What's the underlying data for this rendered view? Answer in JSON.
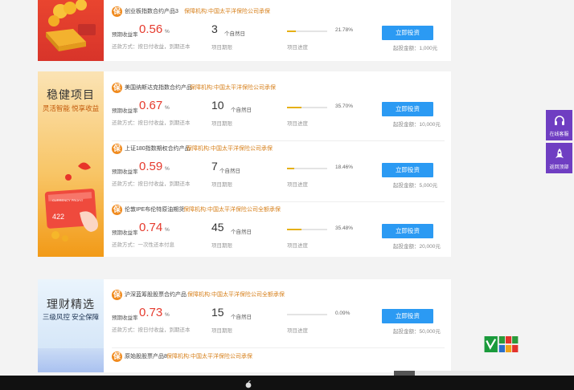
{
  "sections": [
    {
      "title": "",
      "subtitle": "",
      "products": [
        {
          "name": "创业板指数合约产品3",
          "guarantee": "保障机构:中国太平洋保险公司承保",
          "rate_label": "预期收益率",
          "rate": "0.56",
          "pct": "%",
          "repay": "还款方式：按日付收益，到期还本",
          "term": "3",
          "term_unit": "个自然日",
          "term_label": "项目期限",
          "progress": "21.78%",
          "progress_value": 21.78,
          "progress_label": "项目进度",
          "button": "立即投资",
          "min": "起投金额：1,000元"
        }
      ]
    },
    {
      "title": "稳健项目",
      "subtitle": "灵活智能 悦享收益",
      "card_text": "422",
      "card_text_small": "CURRENCY PROFIT",
      "products": [
        {
          "name": "美国纳斯达克指数合约产品",
          "guarantee": "保障机构:中国太平洋保险公司承保",
          "rate_label": "预期收益率",
          "rate": "0.67",
          "pct": "%",
          "repay": "还款方式：按日付收益，到期还本",
          "term": "10",
          "term_unit": "个自然日",
          "term_label": "项目期限",
          "progress": "35.70%",
          "progress_value": 35.7,
          "progress_label": "项目进度",
          "button": "立即投资",
          "min": "起投金额：10,000元"
        },
        {
          "name": "上证180指数期权合约产品",
          "guarantee": "保障机构:中国太平洋保险公司承保",
          "rate_label": "预期收益率",
          "rate": "0.59",
          "pct": "%",
          "repay": "还款方式：按日付收益，到期还本",
          "term": "7",
          "term_unit": "个自然日",
          "term_label": "项目期限",
          "progress": "18.46%",
          "progress_value": 18.46,
          "progress_label": "项目进度",
          "button": "立即投资",
          "min": "起投金额：5,000元"
        },
        {
          "name": "伦敦IPE布伦特原油期货",
          "guarantee": "保障机构:中国太平洋保险公司全额承保",
          "rate_label": "预期收益率",
          "rate": "0.74",
          "pct": "%",
          "repay": "还款方式：一次性还本付息",
          "term": "45",
          "term_unit": "个自然日",
          "term_label": "项目期限",
          "progress": "35.48%",
          "progress_value": 35.48,
          "progress_label": "项目进度",
          "button": "立即投资",
          "min": "起投金额：20,000元"
        }
      ]
    },
    {
      "title": "理财精选",
      "subtitle": "三级风控 安全保障",
      "products": [
        {
          "name": "沪深蓝筹股股票合约产品",
          "guarantee": "保障机构:中国太平洋保险公司全额承保",
          "rate_label": "预期收益率",
          "rate": "0.73",
          "pct": "%",
          "repay": "还款方式：按日付收益，到期还本",
          "term": "15",
          "term_unit": "个自然日",
          "term_label": "项目期限",
          "progress": "0.09%",
          "progress_value": 0.09,
          "progress_label": "项目进度",
          "button": "立即投资",
          "min": "起投金额：50,000元"
        },
        {
          "name": "原始股股票产品8",
          "guarantee": "保障机构:中国太平洋保险公司承保"
        }
      ]
    }
  ],
  "float": {
    "service_label": "在线客服",
    "top_label": "返回顶部"
  },
  "colors": {
    "accent_blue": "#2b9af3",
    "rate_red": "#e53a2d",
    "badge_orange": "#f08a1d",
    "progress_gold": "#e6b015",
    "float_purple": "#6f3ec2"
  }
}
